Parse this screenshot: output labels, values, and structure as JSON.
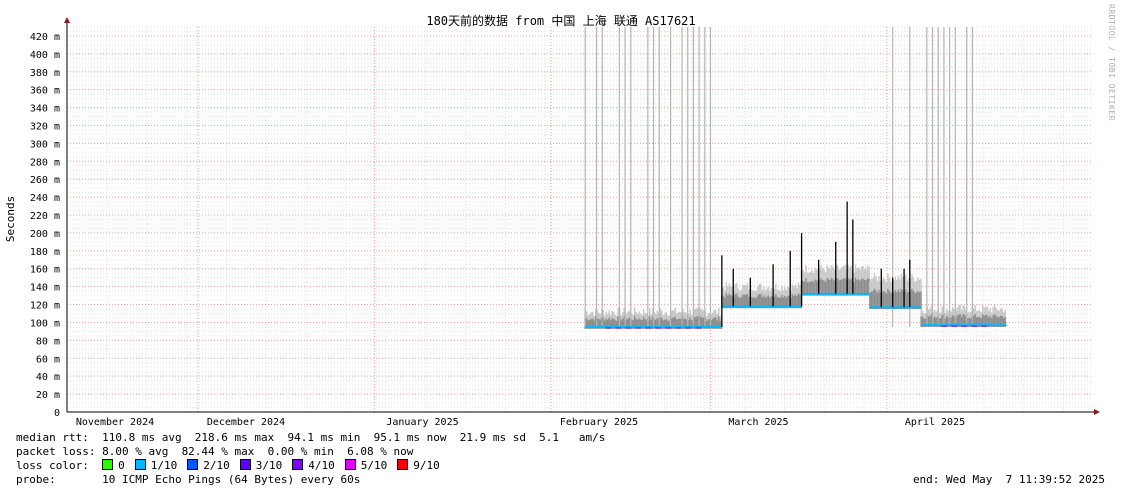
{
  "chart_data": {
    "type": "area",
    "title": "180天前的数据 from 中国 上海 联通 AS17621",
    "ylabel": "Seconds",
    "ylim": [
      0,
      430
    ],
    "y_ticks": [
      {
        "v": 0,
        "label": "0"
      },
      {
        "v": 20,
        "label": "20 m"
      },
      {
        "v": 40,
        "label": "40 m"
      },
      {
        "v": 60,
        "label": "60 m"
      },
      {
        "v": 80,
        "label": "80 m"
      },
      {
        "v": 100,
        "label": "100 m"
      },
      {
        "v": 120,
        "label": "120 m"
      },
      {
        "v": 140,
        "label": "140 m"
      },
      {
        "v": 160,
        "label": "160 m"
      },
      {
        "v": 180,
        "label": "180 m"
      },
      {
        "v": 200,
        "label": "200 m"
      },
      {
        "v": 220,
        "label": "220 m"
      },
      {
        "v": 240,
        "label": "240 m"
      },
      {
        "v": 260,
        "label": "260 m"
      },
      {
        "v": 280,
        "label": "280 m"
      },
      {
        "v": 300,
        "label": "300 m"
      },
      {
        "v": 320,
        "label": "320 m"
      },
      {
        "v": 340,
        "label": "340 m"
      },
      {
        "v": 360,
        "label": "360 m"
      },
      {
        "v": 380,
        "label": "380 m"
      },
      {
        "v": 400,
        "label": "400 m"
      },
      {
        "v": 420,
        "label": "420 m"
      }
    ],
    "x_range": [
      "2024-11-08",
      "2025-05-07"
    ],
    "x_ticks": [
      {
        "date": "2024-11-01",
        "label": "November 2024"
      },
      {
        "date": "2024-12-01",
        "label": "December 2024"
      },
      {
        "date": "2025-01-01",
        "label": "January 2025"
      },
      {
        "date": "2025-02-01",
        "label": "February 2025"
      },
      {
        "date": "2025-03-01",
        "label": "March 2025"
      },
      {
        "date": "2025-04-01",
        "label": "April 2025"
      }
    ],
    "grid": true,
    "segments": [
      {
        "start": "2025-02-07",
        "end": "2025-03-03",
        "median": 95,
        "smoke_top": 112
      },
      {
        "start": "2025-03-03",
        "end": "2025-03-17",
        "median": 118,
        "smoke_top": 140
      },
      {
        "start": "2025-03-17",
        "end": "2025-03-29",
        "median": 132,
        "smoke_top": 160
      },
      {
        "start": "2025-03-29",
        "end": "2025-04-07",
        "median": 117,
        "smoke_top": 150
      },
      {
        "start": "2025-04-07",
        "end": "2025-04-22",
        "median": 97,
        "smoke_top": 115
      }
    ],
    "median_spikes": [
      {
        "date": "2025-03-03",
        "value": 175
      },
      {
        "date": "2025-03-05",
        "value": 160
      },
      {
        "date": "2025-03-08",
        "value": 150
      },
      {
        "date": "2025-03-12",
        "value": 165
      },
      {
        "date": "2025-03-15",
        "value": 180
      },
      {
        "date": "2025-03-17",
        "value": 200
      },
      {
        "date": "2025-03-20",
        "value": 170
      },
      {
        "date": "2025-03-23",
        "value": 190
      },
      {
        "date": "2025-03-25",
        "value": 235
      },
      {
        "date": "2025-03-26",
        "value": 215
      },
      {
        "date": "2025-03-31",
        "value": 160
      },
      {
        "date": "2025-04-02",
        "value": 150
      },
      {
        "date": "2025-04-04",
        "value": 160
      },
      {
        "date": "2025-04-05",
        "value": 170
      }
    ],
    "outage_lines": [
      "2025-02-07",
      "2025-02-09",
      "2025-02-10",
      "2025-02-13",
      "2025-02-14",
      "2025-02-15",
      "2025-02-18",
      "2025-02-19",
      "2025-02-20",
      "2025-02-22",
      "2025-02-24",
      "2025-02-25",
      "2025-02-26",
      "2025-02-27",
      "2025-02-28",
      "2025-03-01",
      "2025-04-02",
      "2025-04-05",
      "2025-04-08",
      "2025-04-09",
      "2025-04-10",
      "2025-04-11",
      "2025-04-12",
      "2025-04-13",
      "2025-04-15",
      "2025-04-16"
    ]
  },
  "stats": {
    "median_rtt": "median rtt:  110.8 ms avg  218.6 ms max  94.1 ms min  95.1 ms now  21.9 ms sd  5.1   am/s",
    "packet_loss": "packet loss: 8.00 % avg  82.44 % max  0.00 % min  6.08 % now",
    "loss_color_label": "loss color:",
    "loss_colors": [
      {
        "label": "0",
        "color": "#26ff00"
      },
      {
        "label": "1/10",
        "color": "#00b8ff"
      },
      {
        "label": "2/10",
        "color": "#0059ff"
      },
      {
        "label": "3/10",
        "color": "#5e00ff"
      },
      {
        "label": "4/10",
        "color": "#7e00ff"
      },
      {
        "label": "5/10",
        "color": "#dd00ff"
      },
      {
        "label": "9/10",
        "color": "#ff0000"
      }
    ],
    "probe": "probe:       10 ICMP Echo Pings (64 Bytes) every 60s",
    "end": "end: Wed May  7 11:39:52 2025"
  },
  "watermark": "RRDTOOL / TOBI OETIKER"
}
